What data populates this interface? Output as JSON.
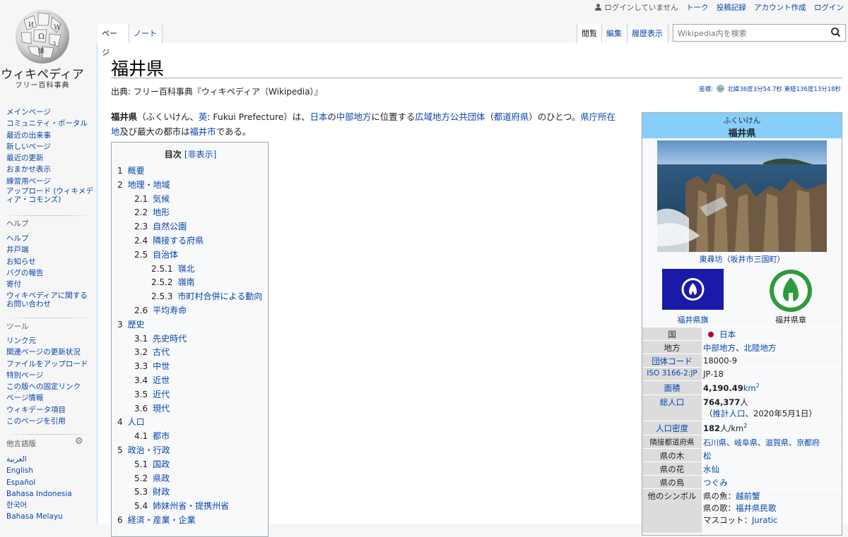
{
  "logo": {
    "title": "ウィキペディア",
    "subtitle": "フリー百科事典"
  },
  "personal_tools": {
    "not_logged_in": "ログインしていません",
    "talk": "トーク",
    "contributions": "投稿記録",
    "create_account": "アカウント作成",
    "login": "ログイン"
  },
  "tabs": {
    "page": "ページ",
    "talk": "ノート",
    "read": "閲覧",
    "edit": "編集",
    "history": "履歴表示"
  },
  "search": {
    "placeholder": "Wikipedia内を検索"
  },
  "sidebar": {
    "nav": [
      "メインページ",
      "コミュニティ・ポータル",
      "最近の出来事",
      "新しいページ",
      "最近の更新",
      "おまかせ表示",
      "練習用ページ"
    ],
    "upload": "アップロード (ウィキメディア・コモンズ)",
    "help_heading": "ヘルプ",
    "help": [
      "ヘルプ",
      "井戸端",
      "お知らせ",
      "バグの報告",
      "寄付"
    ],
    "help_contact": "ウィキペディアに関するお問い合わせ",
    "tools_heading": "ツール",
    "tools": [
      "リンク元",
      "関連ページの更新状況",
      "ファイルをアップロード",
      "特別ページ",
      "この版への固定リンク",
      "ページ情報",
      "ウィキデータ項目",
      "このページを引用"
    ],
    "lang_heading": "他言語版",
    "langs": [
      "العربية",
      "English",
      "Español",
      "Bahasa Indonesia",
      "한국어",
      "Bahasa Melayu"
    ]
  },
  "article": {
    "title": "福井県",
    "from": "出典: フリー百科事典『ウィキペディア（Wikipedia）』",
    "coords_label": "座標:",
    "coords": "北緯36度3分54.7秒 東経136度13分18秒",
    "lead": {
      "bold": "福井県",
      "p1": "（ふくいけん、",
      "en_link": "英",
      "p2": ": Fukui Prefecture）は、",
      "l_japan": "日本",
      "p3": "の",
      "l_chubu": "中部地方",
      "p4": "に位置する",
      "l_kouiki": "広域地方公共団体",
      "p5": "（",
      "l_todofuken": "都道府県",
      "p6": "）のひとつ。",
      "l_kencho1": "県庁所在",
      "l_kencho2": "地",
      "p7": "及び最大の都市は",
      "l_fukui": "福井市",
      "p8": "である。"
    }
  },
  "toc": {
    "title": "目次",
    "toggle": "[非表示]",
    "items": [
      {
        "n": "1",
        "t": "概要",
        "lvl": 1
      },
      {
        "n": "2",
        "t": "地理・地域",
        "lvl": 1
      },
      {
        "n": "2.1",
        "t": "気候",
        "lvl": 2
      },
      {
        "n": "2.2",
        "t": "地形",
        "lvl": 2
      },
      {
        "n": "2.3",
        "t": "自然公園",
        "lvl": 2
      },
      {
        "n": "2.4",
        "t": "隣接する府県",
        "lvl": 2
      },
      {
        "n": "2.5",
        "t": "自治体",
        "lvl": 2
      },
      {
        "n": "2.5.1",
        "t": "嶺北",
        "lvl": 3
      },
      {
        "n": "2.5.2",
        "t": "嶺南",
        "lvl": 3
      },
      {
        "n": "2.5.3",
        "t": "市町村合併による動向",
        "lvl": 3
      },
      {
        "n": "2.6",
        "t": "平均寿命",
        "lvl": 2
      },
      {
        "n": "3",
        "t": "歴史",
        "lvl": 1
      },
      {
        "n": "3.1",
        "t": "先史時代",
        "lvl": 2
      },
      {
        "n": "3.2",
        "t": "古代",
        "lvl": 2
      },
      {
        "n": "3.3",
        "t": "中世",
        "lvl": 2
      },
      {
        "n": "3.4",
        "t": "近世",
        "lvl": 2
      },
      {
        "n": "3.5",
        "t": "近代",
        "lvl": 2
      },
      {
        "n": "3.6",
        "t": "現代",
        "lvl": 2
      },
      {
        "n": "4",
        "t": "人口",
        "lvl": 1
      },
      {
        "n": "4.1",
        "t": "都市",
        "lvl": 2
      },
      {
        "n": "5",
        "t": "政治・行政",
        "lvl": 1
      },
      {
        "n": "5.1",
        "t": "国政",
        "lvl": 2
      },
      {
        "n": "5.2",
        "t": "県政",
        "lvl": 2
      },
      {
        "n": "5.3",
        "t": "財政",
        "lvl": 2
      },
      {
        "n": "5.4",
        "t": "姉妹州省・提携州省",
        "lvl": 2
      },
      {
        "n": "6",
        "t": "経済・産業・企業",
        "lvl": 1
      }
    ]
  },
  "infobox": {
    "kana": "ふくいけん",
    "name": "福井県",
    "photo_caption": "東尋坊（坂井市三国町）",
    "flag_caption": "福井県旗",
    "seal_caption": "福井県章",
    "rows": {
      "country_k": "国",
      "country_v": "日本",
      "region_k": "地方",
      "region_v1": "中部地方",
      "region_sep": "、",
      "region_v2": "北陸地方",
      "code_k": "団体コード",
      "code_v": "18000-9",
      "iso_k": "ISO 3166-2:JP",
      "iso_v": "JP-18",
      "area_k": "面積",
      "area_v": "4,190.49",
      "area_unit": "km",
      "area_sup": "2",
      "pop_k": "総人口",
      "pop_v": "764,377",
      "pop_unit": "人",
      "pop_note_a": "（",
      "pop_note_link": "推計人口",
      "pop_note_b": "、2020年5月1日）",
      "density_k": "人口密度",
      "density_v": "182",
      "density_unit": "人/km",
      "density_sup": "2",
      "neighbors_k": "隣接都道府県",
      "neighbors_v": [
        "石川県",
        "岐阜県",
        "滋賀県",
        "京都府"
      ],
      "tree_k": "県の木",
      "tree_v": "松",
      "flower_k": "県の花",
      "flower_v": "水仙",
      "bird_k": "県の鳥",
      "bird_v": "つぐみ",
      "symbols_k": "他のシンボル",
      "fish_label": "県の魚：",
      "fish_v": "越前蟹",
      "song_label": "県の歌：",
      "song_v": "福井県民歌",
      "mascot_label": "マスコット：",
      "mascot_v": "Juratic"
    }
  },
  "colors": {
    "link": "#0645ad",
    "infobox_header": "#87cefa",
    "flag_blue": "#1a1aa8",
    "seal_green": "#2e9b3a",
    "japan_red": "#bc002d"
  }
}
